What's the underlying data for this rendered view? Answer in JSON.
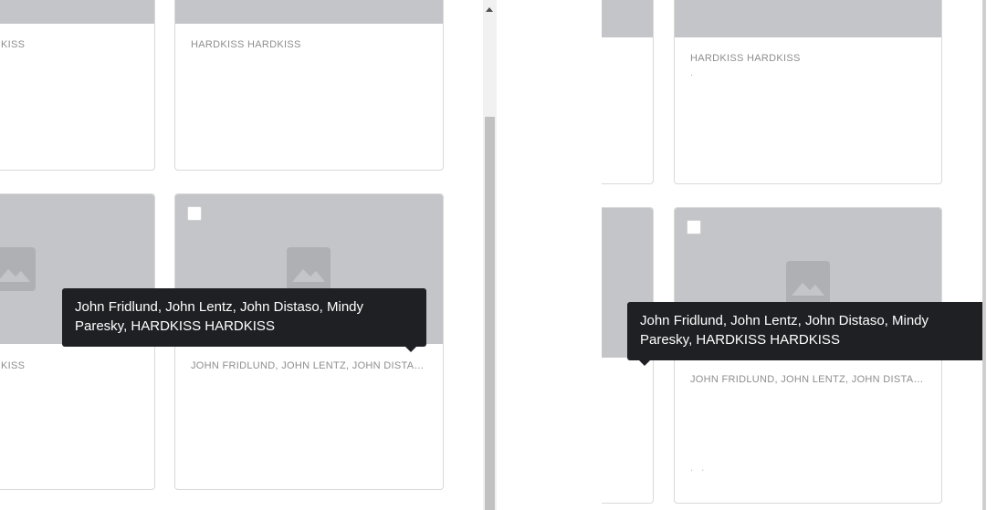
{
  "left_panel": {
    "top_left_card": {
      "meta": "KISS"
    },
    "top_right_card": {
      "meta": "HARDKISS HARDKISS"
    },
    "bottom_left_card": {
      "meta": "KISS",
      "thumb_icon": "image-placeholder-icon"
    },
    "bottom_right_card": {
      "meta": "JOHN FRIDLUND, JOHN LENTZ, JOHN DISTASO, MINDY PARESKY, HARDKISS HARDKISS",
      "thumb_icon": "image-placeholder-icon",
      "checked": false
    },
    "tooltip": {
      "text": "John Fridlund, John Lentz, John Distaso, Mindy Paresky, HARDKISS HARDKISS"
    }
  },
  "right_panel": {
    "top_right_card": {
      "meta": "HARDKISS HARDKISS",
      "sub": "."
    },
    "bottom_right_card": {
      "meta": "JOHN FRIDLUND, JOHN LENTZ, JOHN DISTASO, MINDY PARESKY, HARDKISS HARDKISS",
      "sub": ".   .",
      "thumb_icon": "image-placeholder-icon",
      "checked": false
    },
    "tooltip": {
      "text": "John Fridlund, John Lentz, John Distaso, Mindy Paresky, HARDKISS HARDKISS"
    }
  },
  "colors": {
    "thumb_bg": "#c4c5c8",
    "tooltip_bg": "#1f2024",
    "meta_text": "#8e8e8e"
  }
}
